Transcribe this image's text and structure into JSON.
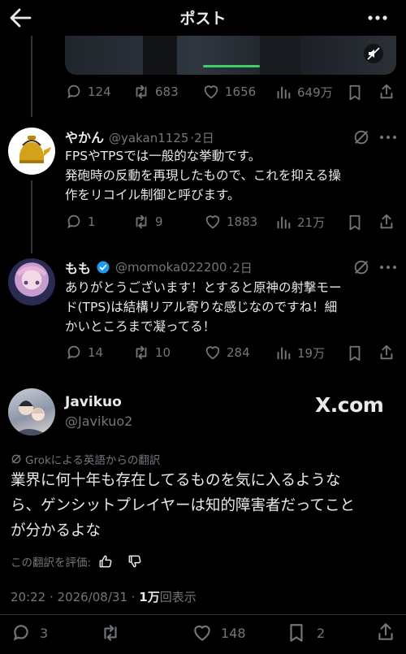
{
  "header": {
    "title": "ポスト"
  },
  "quoted_stats": {
    "replies": "124",
    "reposts": "683",
    "likes": "1656",
    "views": "649万"
  },
  "reply1": {
    "name": "やかん",
    "handle": "@yakan1125",
    "time": "·2日",
    "lines": [
      "FPSやTPSでは一般的な挙動です。",
      "発砲時の反動を再現したもので、これを抑える操",
      "作をリコイル制御と呼びます。"
    ],
    "stats": {
      "replies": "1",
      "reposts": "9",
      "likes": "1883",
      "views": "21万"
    }
  },
  "reply2": {
    "name": "もも",
    "handle": "@momoka022200",
    "time": "·2日",
    "lines": [
      "ありがとうございます！とすると原神の射撃モー",
      "ド(TPS)は結構リアル寄りな感じなのですね！細",
      "かいところまで凝ってる！"
    ],
    "stats": {
      "replies": "14",
      "reposts": "10",
      "likes": "284",
      "views": "19万"
    }
  },
  "main": {
    "name": "Javikuo",
    "handle": "@Javikuo2",
    "watermark": "X.com",
    "translation_note": "Grokによる英語からの翻訳",
    "lines": [
      "業界に何十年も存在してるものを気に入るような",
      "ら、ゲンシットプレイヤーは知的障害者だってこと",
      "が分かるよな"
    ],
    "rate_label": "この翻訳を評価:",
    "timestamp": "20:22 · 2026/08/31 · ",
    "views_count": "1万",
    "views_suffix": "回表示",
    "stats": {
      "replies": "3",
      "likes": "148",
      "bookmarks": "2"
    }
  },
  "colors": {
    "background": "#000000",
    "verified": "#1d9bf0",
    "muted": "#71767b",
    "text": "#e7e9ea"
  }
}
